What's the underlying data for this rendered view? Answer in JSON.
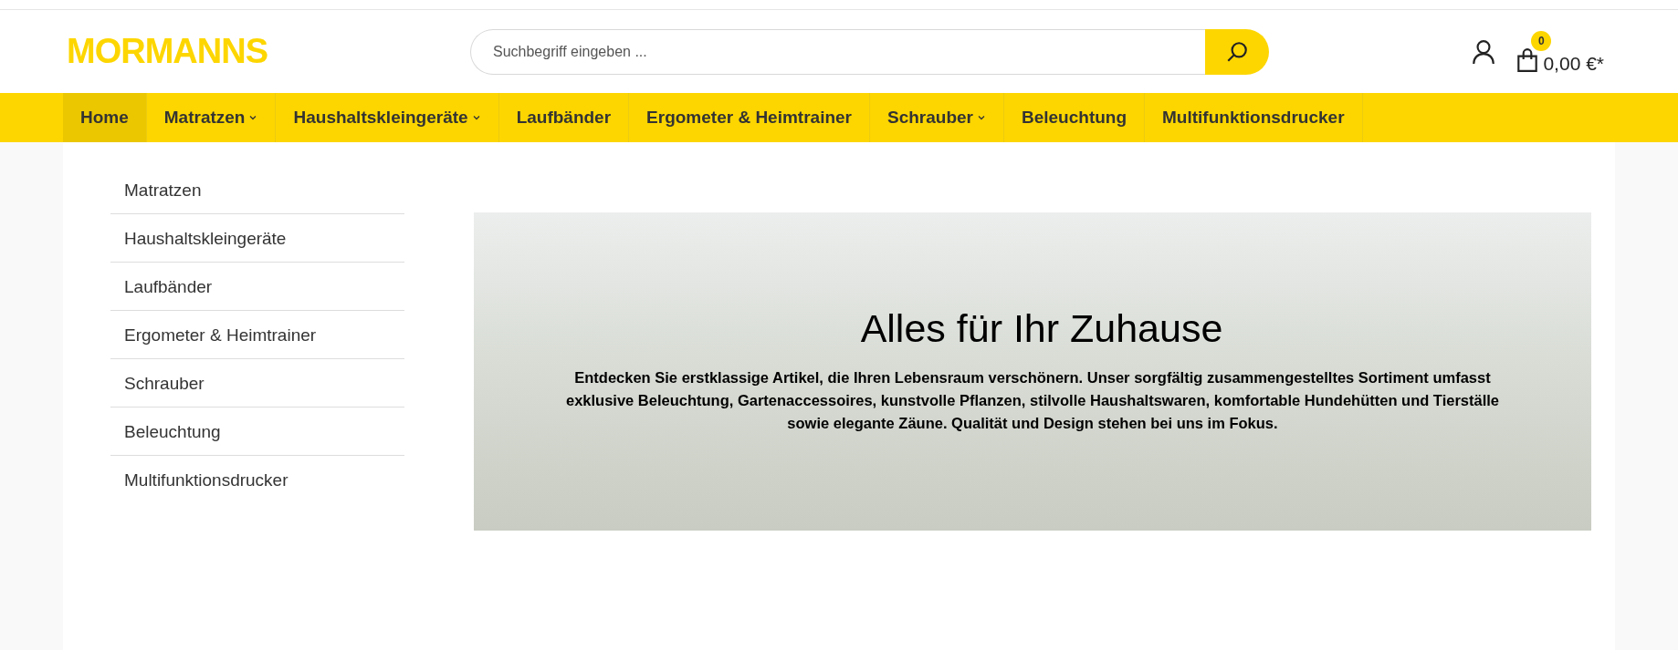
{
  "header": {
    "logo": "MORMANNS",
    "search": {
      "placeholder": "Suchbegriff eingeben ..."
    },
    "cart": {
      "count": "0",
      "total": "0,00 €*"
    }
  },
  "nav": [
    {
      "label": "Home",
      "selected": true,
      "has_dropdown": false
    },
    {
      "label": "Matratzen",
      "selected": false,
      "has_dropdown": true
    },
    {
      "label": "Haushaltskleingeräte",
      "selected": false,
      "has_dropdown": true
    },
    {
      "label": "Laufbänder",
      "selected": false,
      "has_dropdown": false
    },
    {
      "label": "Ergometer & Heimtrainer",
      "selected": false,
      "has_dropdown": false
    },
    {
      "label": "Schrauber",
      "selected": false,
      "has_dropdown": true
    },
    {
      "label": "Beleuchtung",
      "selected": false,
      "has_dropdown": false
    },
    {
      "label": "Multifunktionsdrucker",
      "selected": false,
      "has_dropdown": false
    }
  ],
  "sidebar": {
    "items": [
      "Matratzen",
      "Haushaltskleingeräte",
      "Laufbänder",
      "Ergometer & Heimtrainer",
      "Schrauber",
      "Beleuchtung",
      "Multifunktionsdrucker"
    ]
  },
  "hero": {
    "title": "Alles für Ihr Zuhause",
    "text": "Entdecken Sie erstklassige Artikel, die Ihren Lebensraum verschönern. Unser sorgfältig zusammengestelltes Sortiment umfasst exklusive Beleuchtung, Gartenaccessoires, kunstvolle Pflanzen, stilvolle Haushaltswaren, komfortable Hundehütten und Tierställe sowie elegante Zäune. Qualität und Design stehen bei uns im Fokus."
  }
}
